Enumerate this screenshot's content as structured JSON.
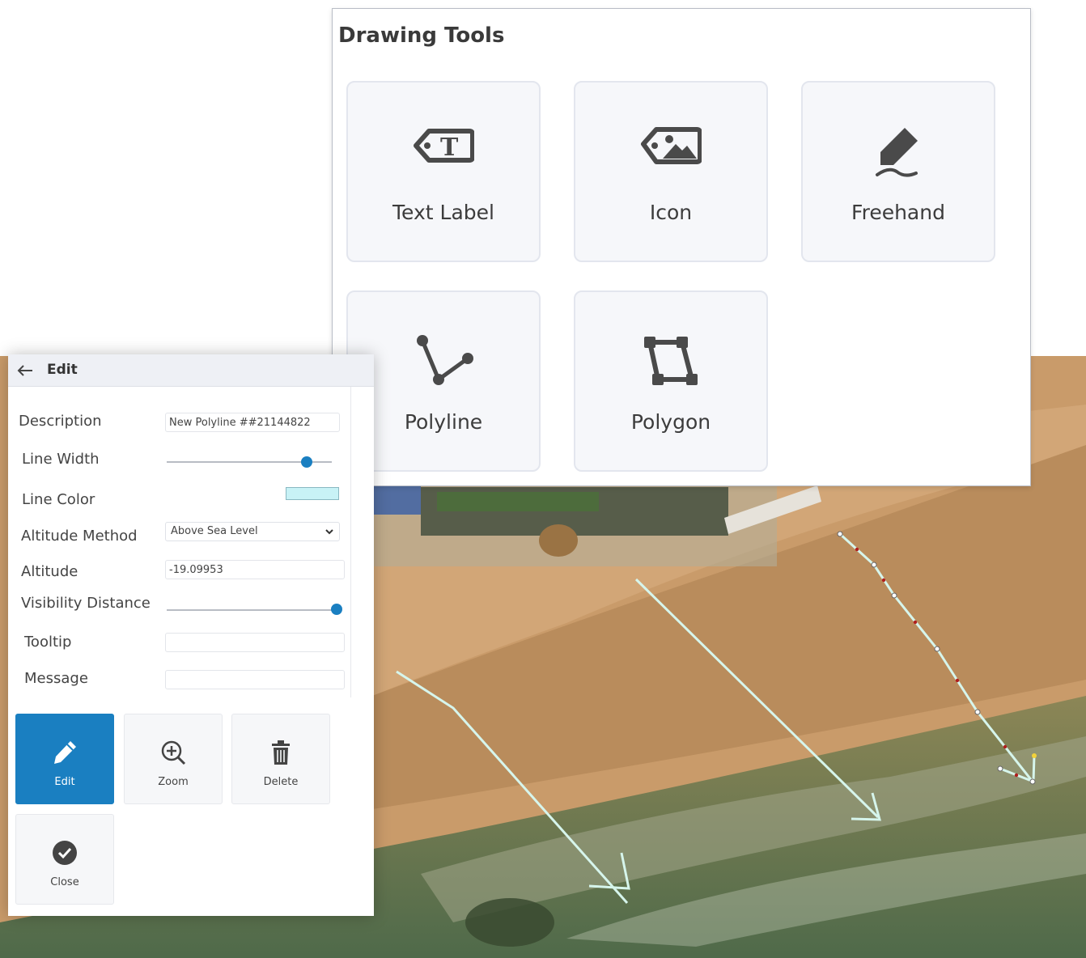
{
  "drawing_tools": {
    "title": "Drawing Tools",
    "tools": [
      {
        "label": "Text Label",
        "icon": "text-label-tag-icon"
      },
      {
        "label": "Icon",
        "icon": "image-tag-icon"
      },
      {
        "label": "Freehand",
        "icon": "freehand-pen-icon"
      },
      {
        "label": "Polyline",
        "icon": "polyline-icon"
      },
      {
        "label": "Polygon",
        "icon": "polygon-icon"
      }
    ]
  },
  "edit_panel": {
    "title": "Edit",
    "back_icon": "arrow-left-icon",
    "fields": {
      "description": {
        "label": "Description",
        "value": "New Polyline ##21144822"
      },
      "line_width": {
        "label": "Line Width",
        "level": 0.85
      },
      "line_color": {
        "label": "Line Color",
        "color": "#c8f2f6"
      },
      "altitude_method": {
        "label": "Altitude Method",
        "value": "Above Sea Level"
      },
      "altitude": {
        "label": "Altitude",
        "value": "-19.09953"
      },
      "visibility_distance": {
        "label": "Visibility Distance",
        "level": 1.0
      },
      "tooltip": {
        "label": "Tooltip",
        "value": ""
      },
      "message": {
        "label": "Message",
        "value": ""
      }
    },
    "actions": [
      {
        "label": "Edit",
        "icon": "pencil-icon",
        "active": true
      },
      {
        "label": "Zoom",
        "icon": "zoom-in-icon",
        "active": false
      },
      {
        "label": "Delete",
        "icon": "trash-icon",
        "active": false
      },
      {
        "label": "Close",
        "icon": "check-circle-icon",
        "active": false
      }
    ]
  },
  "colors": {
    "accent": "#1a7fc1",
    "drawn_line": "#d6f5ec"
  }
}
